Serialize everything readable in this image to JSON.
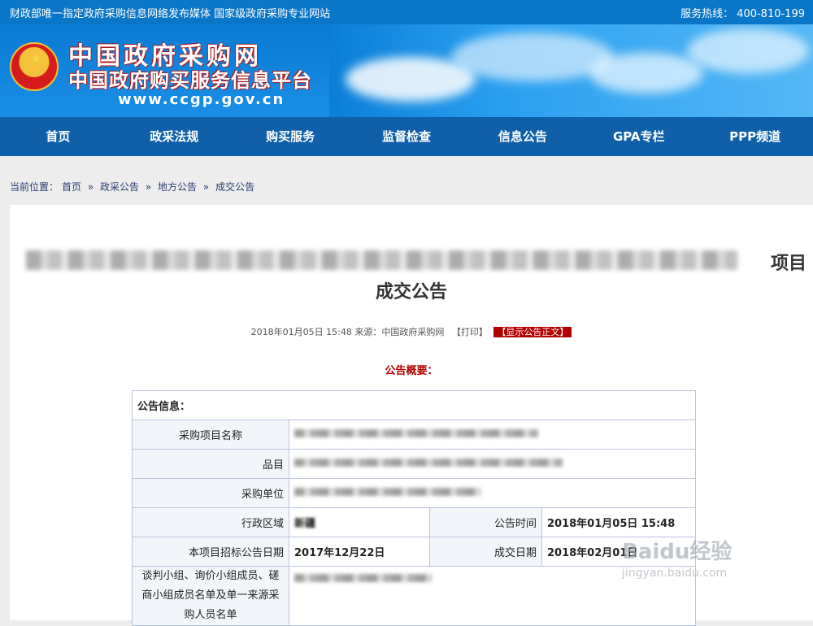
{
  "topbar": {
    "left_text": "财政部唯一指定政府采购信息网络发布媒体 国家级政府采购专业网站",
    "hotline_label": "服务热线：",
    "hotline_value": "400-810-199"
  },
  "header": {
    "site_name": "中国政府采购网",
    "site_subtitle": "中国政府购买服务信息平台",
    "url": "www.ccgp.gov.cn"
  },
  "nav": [
    "首页",
    "政采法规",
    "购买服务",
    "监督检查",
    "信息公告",
    "GPA专栏",
    "PPP频道"
  ],
  "breadcrumb": {
    "label": "当前位置：",
    "items": [
      "首页",
      "政采公告",
      "地方公告",
      "成交公告"
    ],
    "sep": "»"
  },
  "notice": {
    "title_suffix": "项目",
    "title_line2": "成交公告",
    "meta_time": "2018年01月05日  15:48",
    "meta_source": "来源：中国政府采购网",
    "print": "【打印】",
    "show_text": "【显示公告正文】",
    "summary_heading": "公告概要："
  },
  "table": {
    "section": "公告信息：",
    "rows": {
      "project_name": "采购项目名称",
      "item": "品目",
      "buyer": "采购单位",
      "region": "行政区域",
      "region_value": "新疆",
      "announce_time_label": "公告时间",
      "announce_time_value": "2018年01月05日  15:48",
      "bid_date_label": "本项目招标公告日期",
      "bid_date_value": "2017年12月22日",
      "deal_date_label": "成交日期",
      "deal_date_value": "2018年02月01日",
      "members_label": "谈判小组、询价小组成员、磋商小组成员名单及单一来源采购人员名单"
    }
  },
  "watermark": {
    "brand": "Baidu经验",
    "url": "jingyan.baidu.com"
  }
}
